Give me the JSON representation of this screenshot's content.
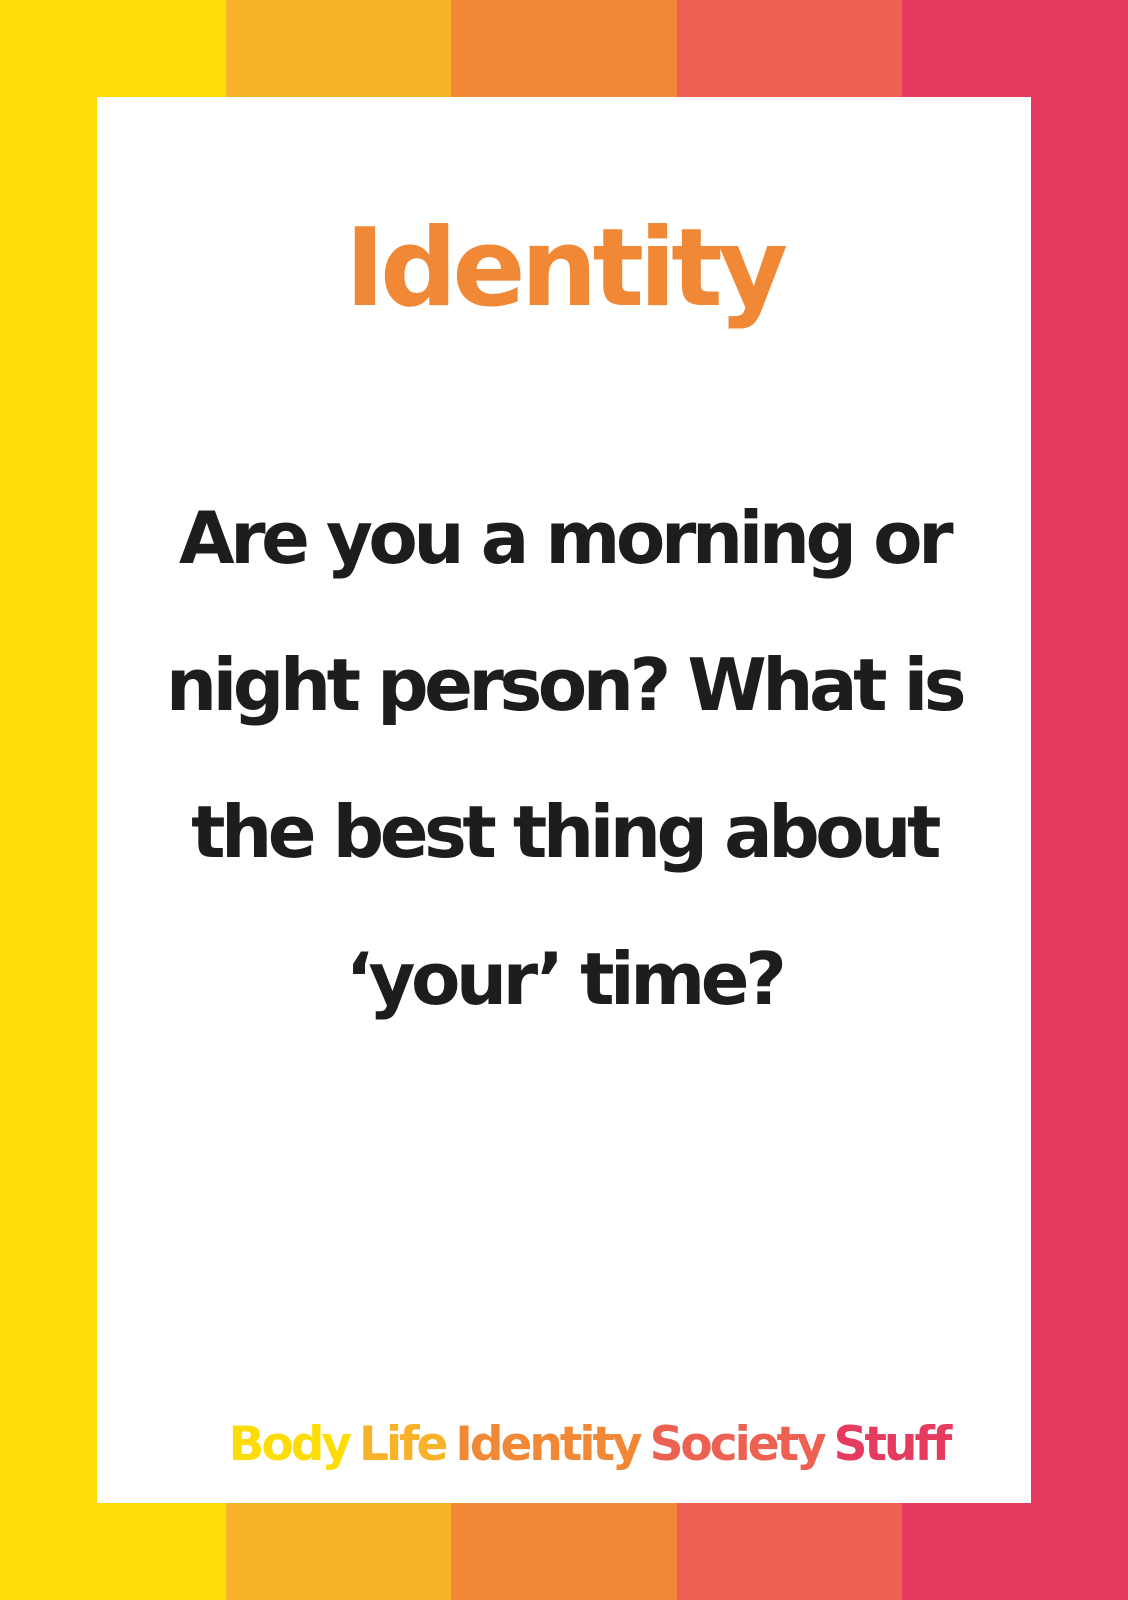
{
  "colors": {
    "yellow": "#fedd07",
    "light_orange": "#f8b22a",
    "orange": "#f08836",
    "coral": "#ec6151",
    "pink": "#e53b5f",
    "text_dark": "#1d1d1b",
    "card": "#ffffff"
  },
  "stripes": [
    "#fedd07",
    "#f8b22a",
    "#f08836",
    "#ec6151",
    "#e53b5f"
  ],
  "card": {
    "title": "Identity",
    "title_color": "#f08836",
    "question": "Are you a morning or night person? What is the best thing about ‘your’ time?"
  },
  "footer": {
    "categories": [
      {
        "label": "Body",
        "color": "#fedd07"
      },
      {
        "label": "Life",
        "color": "#f8b22a"
      },
      {
        "label": "Identity",
        "color": "#f08836"
      },
      {
        "label": "Society",
        "color": "#ec6151"
      },
      {
        "label": "Stuff",
        "color": "#e53b5f"
      }
    ]
  }
}
